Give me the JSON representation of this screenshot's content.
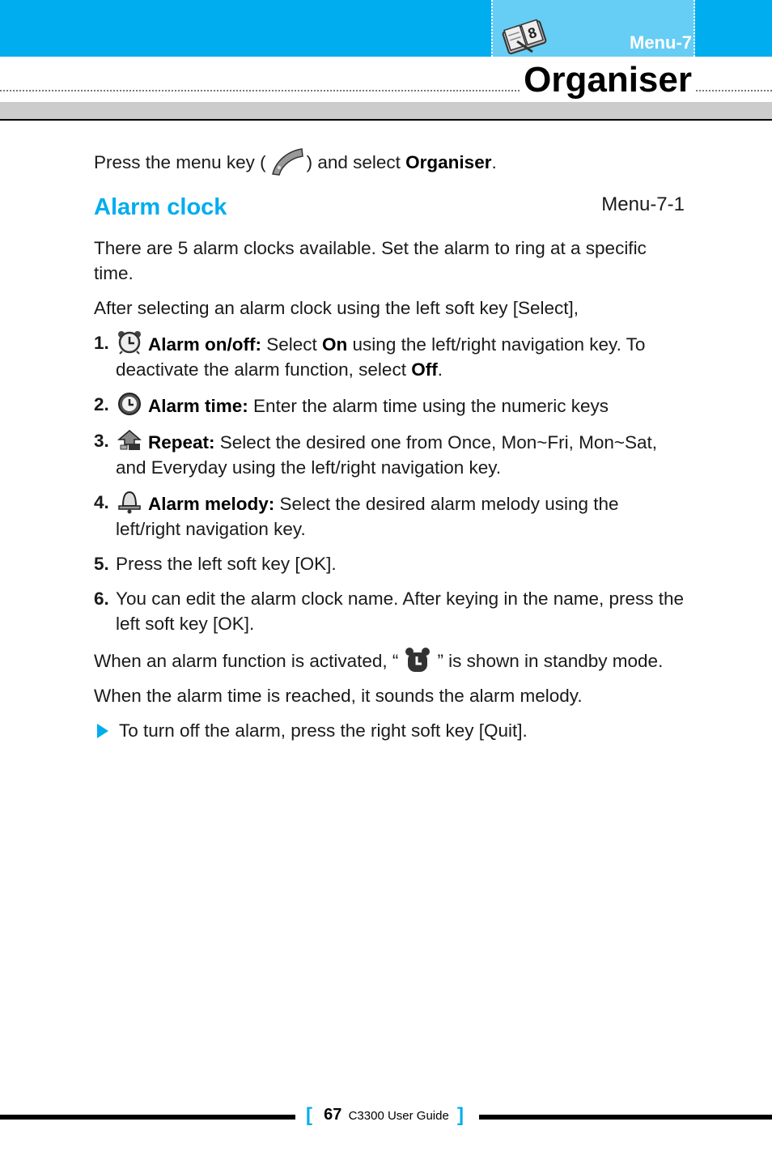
{
  "header": {
    "menu_tab_label": "Menu-7",
    "menu_icon": "organiser-book-icon",
    "title": "Organiser"
  },
  "intro": {
    "before": "Press the menu key (",
    "icon": "menu-key-icon",
    "middle": ") and select ",
    "bold": "Organiser",
    "after": "."
  },
  "section": {
    "title": "Alarm clock",
    "ref": "Menu-7-1",
    "paragraphs": [
      "There are 5 alarm clocks available. Set the alarm to ring at a specific time.",
      "After selecting an alarm clock using the left soft key [Select],"
    ],
    "steps": [
      {
        "num": "1.",
        "icon": "alarm-clock-icon",
        "label": "Alarm on/off:",
        "t1": " Select ",
        "b1": "On",
        "t2": " using the left/right navigation key. To deactivate the alarm function, select ",
        "b2": "Off",
        "t3": "."
      },
      {
        "num": "2.",
        "icon": "clock-icon",
        "label": "Alarm time:",
        "text": " Enter the alarm time using the numeric keys"
      },
      {
        "num": "3.",
        "icon": "repeat-icon",
        "label": "Repeat:",
        "text": " Select the desired one from Once, Mon~Fri, Mon~Sat, and Everyday using the left/right navigation key."
      },
      {
        "num": "4.",
        "icon": "bell-icon",
        "label": "Alarm melody:",
        "text": " Select the desired alarm melody using the left/right navigation key."
      },
      {
        "num": "5.",
        "text": "Press the left soft key [OK]."
      },
      {
        "num": "6.",
        "text": "You can edit the alarm clock name. After keying in the name, press the left soft key [OK]."
      }
    ],
    "standby": {
      "before": "When an alarm function is activated, “",
      "icon": "standby-alarm-icon",
      "after": "” is shown in standby mode."
    },
    "reached": "When the alarm time is reached, it sounds the alarm melody.",
    "tip": "To turn off the alarm, press the right soft key [Quit]."
  },
  "footer": {
    "bracket_open": "[",
    "page_number": "67",
    "guide": "C3300 User Guide",
    "bracket_close": "]"
  },
  "colors": {
    "accent": "#00adee",
    "tab": "#66cdf5",
    "grey_bar": "#cccccc"
  }
}
